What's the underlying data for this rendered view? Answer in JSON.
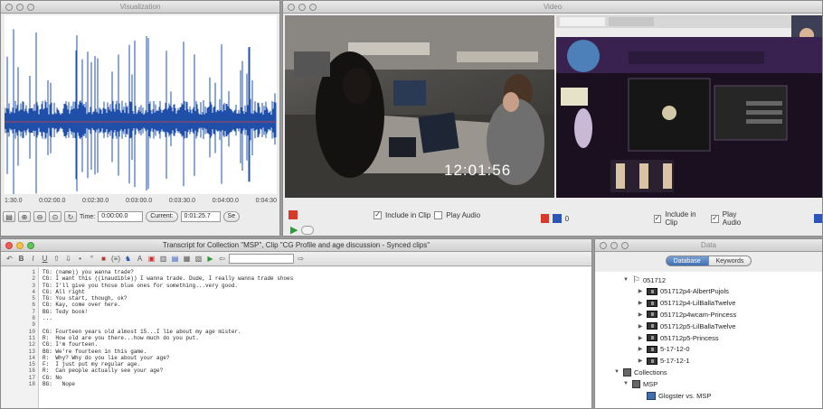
{
  "visualization": {
    "title": "Visualization",
    "time_ticks": [
      "1:30.0",
      "0:02:00.0",
      "0:02:30.0",
      "0:03:00.0",
      "0:03:30.0",
      "0:04:00.0",
      "0:04:30"
    ],
    "time_label": "Time:",
    "time_value": "0:00:00.0",
    "current_label": "Current:",
    "current_value": "0:01:25.7",
    "sel_label": "Se"
  },
  "video": {
    "title": "Video",
    "timecode": "12:01:56",
    "left_controls": {
      "include_in_clip": "Include in Clip",
      "play_audio": "Play Audio",
      "include_checked": true,
      "play_checked": false
    },
    "right_controls": {
      "value": "0",
      "include_in_clip": "Include in Clip",
      "play_audio": "Play Audio",
      "include_checked": true,
      "play_checked": true
    },
    "colors": {
      "red": "#d63a2a",
      "blue": "#2d55b8"
    }
  },
  "transcript": {
    "title": "Transcript for Collection \"MSP\", Clip \"CG Profile and age discussion - Synced clips\"",
    "line_numbers": [
      "1",
      "2",
      "3",
      "4",
      "5",
      "6",
      "7",
      "8",
      "9",
      "10",
      "11",
      "12",
      "13",
      "14",
      "15",
      "16",
      "17",
      "18"
    ],
    "lines": [
      "TG: (name)) you wanna trade?",
      "CG: I want this ((inaudible)) I wanna trade. Dude, I really wanna trade shoes",
      "TG: I'll give you those blue ones for something...very good.",
      "CG: All right",
      "TG: You start, though, ok?",
      "CG: Kay, come over here.",
      "BG: Tedy book!",
      "...",
      "",
      "CG: Fourteen years old almost 15...I lie about my age mister.",
      "R:  How old are you there...how much do you put.",
      "CG: I'm fourteen.",
      "BG: We're fourteen in this game.",
      "R:  Why? Why do you lie about your age?",
      "F:  I just put my regular age.",
      "R:  Can people actually see your age?",
      "CG: No",
      "BG:   Nope"
    ]
  },
  "data_panel": {
    "title": "Data",
    "tabs": [
      "Database",
      "Keywords"
    ],
    "tree": [
      {
        "label": "051712",
        "icon": "series-icon",
        "expanded": true
      },
      {
        "label": "051712p4-AlbertPujols",
        "icon": "video-icon"
      },
      {
        "label": "051712p4-LilBallaTwelve",
        "icon": "video-icon"
      },
      {
        "label": "051712p4wcam-Princess",
        "icon": "video-icon"
      },
      {
        "label": "051712p5-LilBallaTwelve",
        "icon": "video-icon"
      },
      {
        "label": "051712p5-Princess",
        "icon": "video-icon"
      },
      {
        "label": "5-17-12-0",
        "icon": "video-icon"
      },
      {
        "label": "5-17-12-1",
        "icon": "video-icon"
      },
      {
        "label": "Collections",
        "icon": "folder-icon",
        "expanded": true
      },
      {
        "label": "MSP",
        "icon": "folder-icon",
        "expanded": true
      },
      {
        "label": "Glogster vs. MSP",
        "icon": "collection-icon"
      }
    ]
  }
}
